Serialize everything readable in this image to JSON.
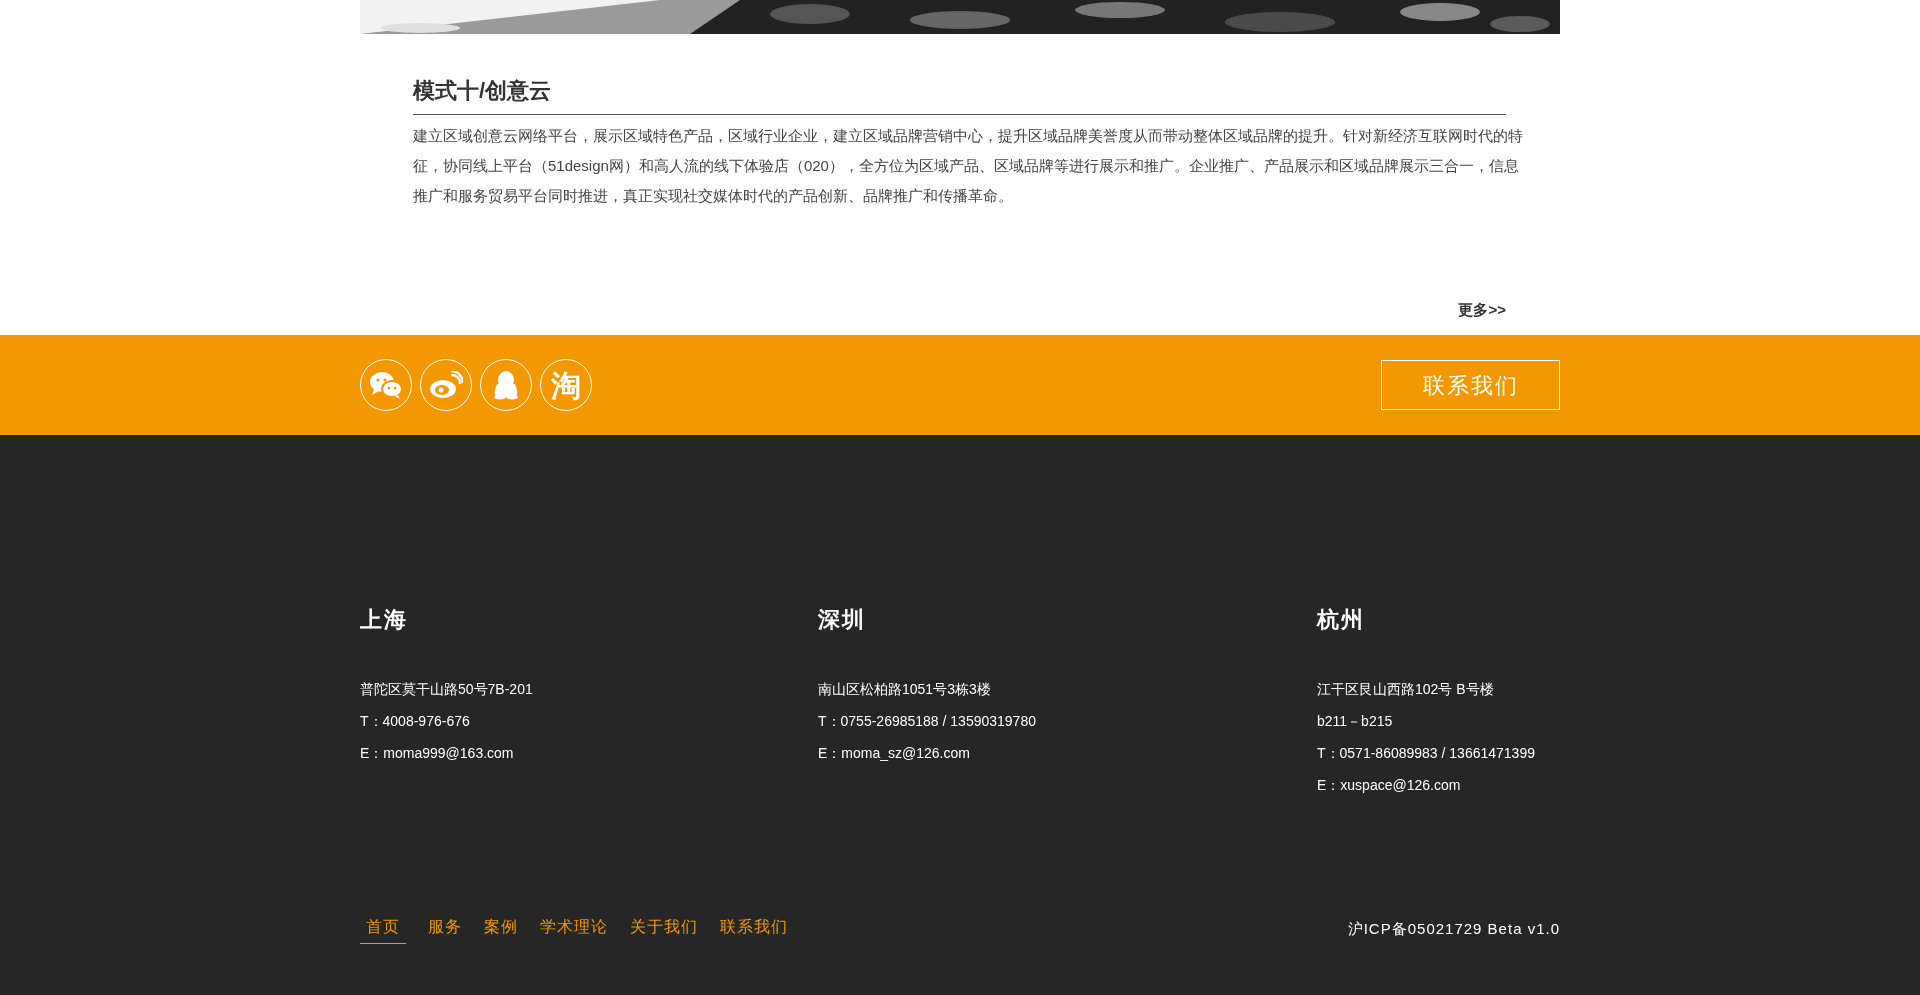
{
  "section": {
    "title": "模式十/创意云",
    "body": "建立区域创意云网络平台，展示区域特色产品，区域行业企业，建立区域品牌营销中心，提升区域品牌美誉度从而带动整体区域品牌的提升。针对新经济互联网时代的特征，协同线上平台（51design网）和高人流的线下体验店（020），全方位为区域产品、区域品牌等进行展示和推广。企业推广、产品展示和区域品牌展示三合一，信息推广和服务贸易平台同时推进，真正实现社交媒体时代的产品创新、品牌推广和传播革命。",
    "more": "更多>>"
  },
  "social": [
    {
      "kind": "chat"
    },
    {
      "kind": "eye"
    },
    {
      "kind": "penguin"
    },
    {
      "kind": "text",
      "label": "淘"
    }
  ],
  "contact_button": "联系我们",
  "offices": [
    {
      "city": "上海",
      "lines": [
        "普陀区莫干山路50号7B-201",
        "T：4008-976-676",
        "E：moma999@163.com"
      ]
    },
    {
      "city": "深圳",
      "lines": [
        "南山区松柏路1051号3栋3楼",
        "T：0755-26985188 / 13590319780",
        "E：moma_sz@126.com"
      ]
    },
    {
      "city": "杭州",
      "lines": [
        "江干区艮山西路102号 B号楼",
        "b211－b215",
        "T：0571-86089983 / 13661471399",
        "E：xuspace@126.com"
      ]
    }
  ],
  "nav": [
    {
      "label": "首页",
      "selected": true
    },
    {
      "label": "服务",
      "selected": false
    },
    {
      "label": "案例",
      "selected": false
    },
    {
      "label": "学术理论",
      "selected": false
    },
    {
      "label": "关于我们",
      "selected": false
    },
    {
      "label": "联系我们",
      "selected": false
    }
  ],
  "icp": "沪ICP备05021729 Beta v1.0"
}
